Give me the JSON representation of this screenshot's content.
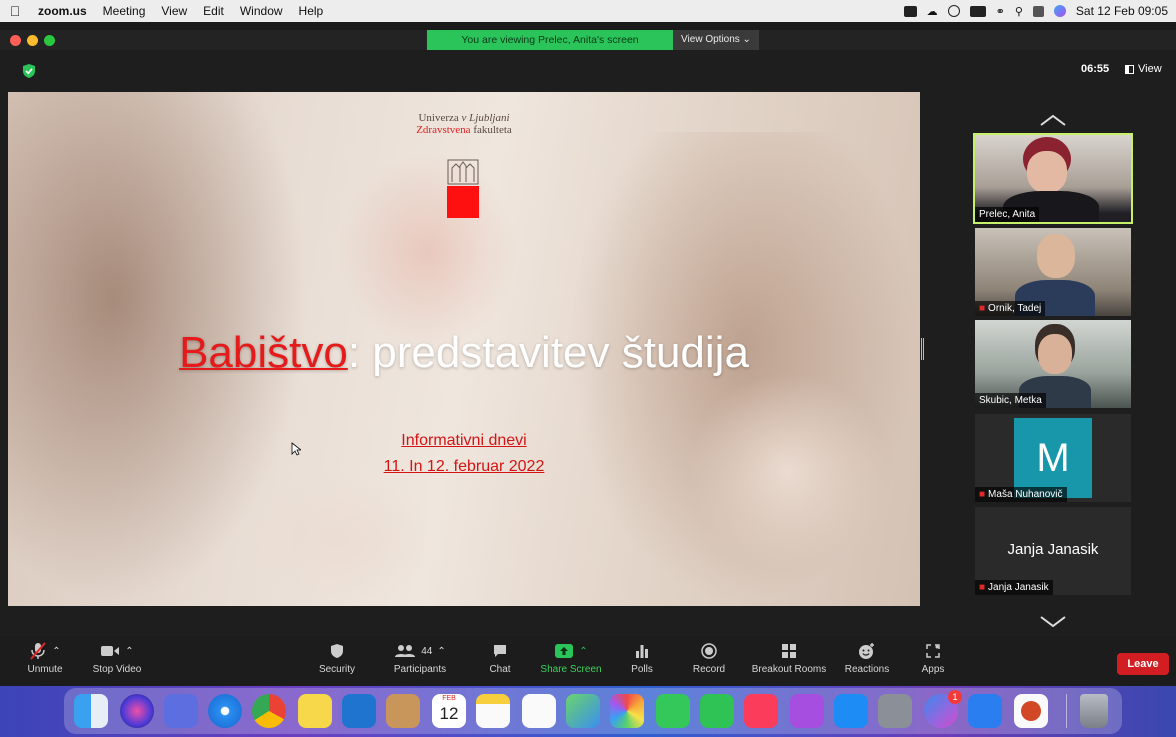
{
  "menubar": {
    "app_name": "zoom.us",
    "items": [
      "Meeting",
      "View",
      "Edit",
      "Window",
      "Help"
    ],
    "datetime": "Sat 12 Feb  09:05"
  },
  "window": {
    "banner_text": "You are viewing Prelec, Anita's screen",
    "view_options": "View Options ⌄",
    "timer": "06:55",
    "view_label": "View"
  },
  "slide": {
    "university_prefix": "Univerza ",
    "university_v": "v ",
    "university_city": "Ljubljani",
    "faculty_red": "Zdravstvena",
    "faculty_rest": " fakulteta",
    "title_highlight": "Babištvo",
    "title_rest": ": predstavitev študija",
    "subtitle_1": "Informativni dnevi",
    "subtitle_2": "11. In 12. februar 2022"
  },
  "participants": [
    {
      "name": "Prelec, Anita",
      "muted": false,
      "active": true
    },
    {
      "name": "Ornik, Tadej",
      "muted": true,
      "active": false
    },
    {
      "name": "Skubic, Metka",
      "muted": false,
      "active": false
    },
    {
      "name": "Maša Nuhanovič",
      "muted": true,
      "avatar_letter": "M"
    },
    {
      "name": "Janja Janasik",
      "muted": true,
      "display": "Janja Janasik"
    }
  ],
  "toolbar": {
    "unmute": "Unmute",
    "stop_video": "Stop Video",
    "security": "Security",
    "participants": "Participants",
    "participants_count": "44",
    "chat": "Chat",
    "share_screen": "Share Screen",
    "polls": "Polls",
    "record": "Record",
    "breakout_rooms": "Breakout Rooms",
    "reactions": "Reactions",
    "apps": "Apps",
    "leave": "Leave"
  },
  "dock": {
    "calendar_month": "FEB",
    "calendar_day": "12",
    "messenger_badge": "1"
  },
  "colors": {
    "share_green": "#2bc45a",
    "leave_red": "#d21e22",
    "active_speaker": "#c6f06a",
    "slide_red": "#e51b1b",
    "avatar_teal": "#1797a9"
  }
}
